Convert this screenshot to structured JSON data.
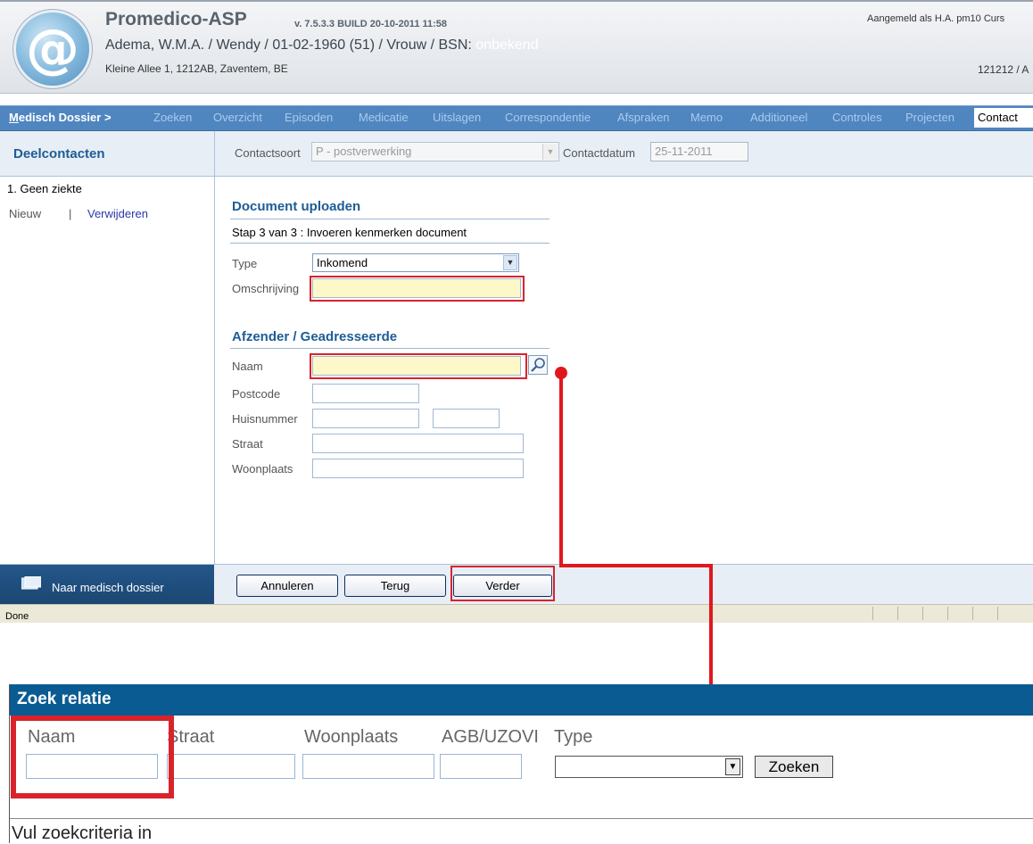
{
  "header": {
    "app_name": "Promedico-ASP",
    "version": "v. 7.5.3.3 BUILD 20-10-2011 11:58",
    "logged_in": "Aangemeld als H.A. pm10   Curs",
    "patient": "Adema, W.M.A. / Wendy / 01-02-1960 (51) / Vrouw / BSN:",
    "bsn": "onbekend",
    "address": "Kleine Allee 1, 1212AB, Zaventem, BE",
    "patient_id": "121212 / A"
  },
  "nav": {
    "dossier": "Medisch Dossier >",
    "items": [
      "Zoeken",
      "Overzicht",
      "Episoden",
      "Medicatie",
      "Uitslagen",
      "Correspondentie",
      "Afspraken",
      "Memo",
      "Additioneel",
      "Controles",
      "Projecten"
    ],
    "contact": "Contact"
  },
  "left": {
    "title": "Deelcontacten",
    "item": "1. Geen ziekte",
    "nieuw": "Nieuw",
    "sep": "|",
    "verwijderen": "Verwijderen",
    "naar_dossier": "Naar medisch dossier"
  },
  "contact": {
    "soort_label": "Contactsoort",
    "soort_value": "P - postverwerking",
    "datum_label": "Contactdatum",
    "datum_value": "25-11-2011"
  },
  "upload": {
    "title": "Document uploaden",
    "step": "Stap 3 van 3 : Invoeren kenmerken document",
    "type_label": "Type",
    "type_value": "Inkomend",
    "omschrijving_label": "Omschrijving"
  },
  "afzender": {
    "title": "Afzender / Geadresseerde",
    "naam": "Naam",
    "postcode": "Postcode",
    "huisnummer": "Huisnummer",
    "straat": "Straat",
    "woonplaats": "Woonplaats"
  },
  "buttons": {
    "annuleren": "Annuleren",
    "terug": "Terug",
    "verder": "Verder"
  },
  "status": {
    "text": "Done"
  },
  "dialog": {
    "title": "Zoek relatie",
    "naam": "Naam",
    "straat": "Straat",
    "woonplaats": "Woonplaats",
    "agb": "AGB/UZOVI",
    "type": "Type",
    "zoeken": "Zoeken",
    "hint": "Vul zoekcriteria in"
  },
  "colors": {
    "highlight": "#d9232b",
    "nav": "#4f86c0",
    "dialog_header": "#0a5b91",
    "required_field": "#fdf8c8"
  }
}
